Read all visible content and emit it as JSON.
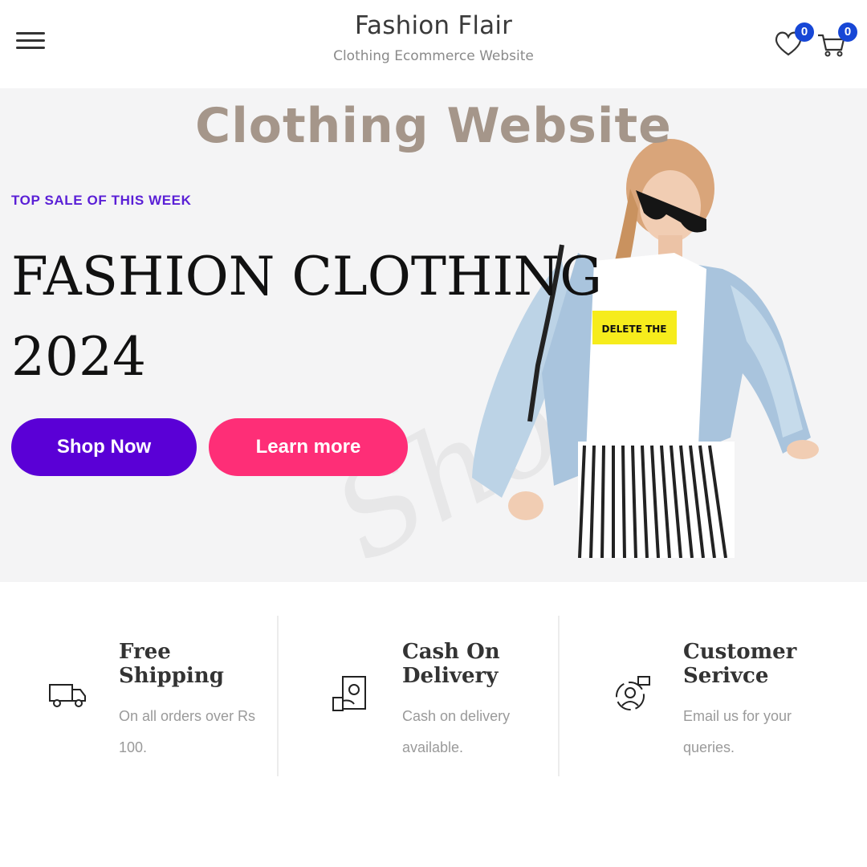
{
  "header": {
    "title": "Fashion Flair",
    "subtitle": "Clothing Ecommerce Website",
    "wishlist_count": "0",
    "cart_count": "0",
    "icons": [
      "menu-icon",
      "heart-icon",
      "cart-icon"
    ]
  },
  "hero": {
    "overlay_title": "Clothing Website",
    "eyebrow": "TOP SALE OF THIS WEEK",
    "headline_line1": "FASHION CLOTHING",
    "headline_line2": "2024",
    "shop_now": "Shop Now",
    "learn_more": "Learn more",
    "tshirt_text": "DELETE THE",
    "watermark": "Shopis"
  },
  "features": [
    {
      "title": "Free Shipping",
      "desc": "On all orders over Rs 100.",
      "icon": "truck-icon"
    },
    {
      "title": "Cash On Delivery",
      "desc": "Cash on delivery available.",
      "icon": "cash-icon"
    },
    {
      "title": "Customer Serivce",
      "desc": "Email us for your queries.",
      "icon": "support-icon"
    }
  ],
  "colors": {
    "primary": "#5a00d6",
    "accent": "#fe2e77",
    "badge": "#1747d6",
    "overlay_title": "#a5968a"
  }
}
